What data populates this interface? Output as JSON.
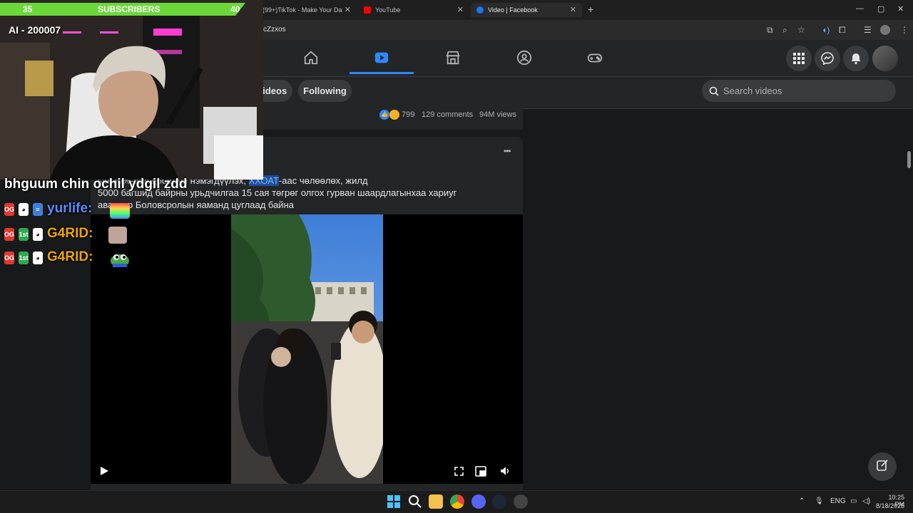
{
  "browser": {
    "tabs": [
      {
        "title": "(99+)TikTok - Make Your Da",
        "icon": "tiktok-icon"
      },
      {
        "title": "YouTube",
        "icon": "youtube-icon"
      },
      {
        "title": "Video | Facebook",
        "icon": "facebook-icon",
        "active": true
      }
    ],
    "url_fragment": "cZzxos"
  },
  "overlay": {
    "sub_goal": {
      "current": "35",
      "label": "SUBSCRIBERS",
      "target": "40"
    },
    "ai_counter": "AI - 200007",
    "chat_messages": [
      {
        "user": "",
        "text": "bhguum chin ochil ydgil zdd"
      },
      {
        "user": "yurlife:",
        "badges": [
          "OG"
        ]
      },
      {
        "user": "G4RID:",
        "badges": [
          "OG",
          "1st"
        ]
      },
      {
        "user": "G4RID:",
        "badges": [
          "OG",
          "1st"
        ]
      }
    ]
  },
  "facebook": {
    "filters": [
      {
        "label": "Videos"
      },
      {
        "label": "Following"
      }
    ],
    "search_placeholder": "Search videos",
    "prev_post": {
      "reactions": "799",
      "comments": "129 comments",
      "views": "94M views"
    },
    "post": {
      "more_label": "•••",
      "caption_line1_pre": "ын 30%-аас доошгүй нэмэгдүүлэх, ",
      "caption_highlight": "ХХОАТ",
      "caption_line1_post": "-аас чөлөөлөх, жилд",
      "caption_line2": "5000 багшид байрны урьдчилгаа 15 сая төгрөг олгох гурван шаардлагынхаа хариуг",
      "caption_line3": "авахаар Боловсролын яаманд цуглаад байна"
    }
  },
  "taskbar": {
    "lang": "ENG",
    "time": "10:25 PM",
    "date": "8/18/2025"
  },
  "colors": {
    "fb_blue": "#2d88ff",
    "sub_green": "#6bd83a",
    "highlight": "#1f4f99"
  }
}
